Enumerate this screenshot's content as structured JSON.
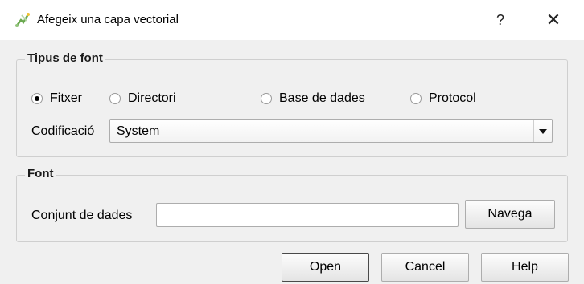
{
  "window": {
    "title": "Afegeix una capa vectorial",
    "app_icon": "qgis-vector-icon",
    "help_symbol": "?",
    "close_symbol": "✕"
  },
  "source_type": {
    "legend": "Tipus de font",
    "options": [
      {
        "label": "Fitxer",
        "selected": true
      },
      {
        "label": "Directori",
        "selected": false
      },
      {
        "label": "Base de dades",
        "selected": false
      },
      {
        "label": "Protocol",
        "selected": false
      }
    ],
    "encoding_label": "Codificació",
    "encoding_value": "System"
  },
  "source": {
    "legend": "Font",
    "dataset_label": "Conjunt de dades",
    "dataset_value": "",
    "browse_label": "Navega"
  },
  "buttons": {
    "open": "Open",
    "cancel": "Cancel",
    "help": "Help"
  }
}
